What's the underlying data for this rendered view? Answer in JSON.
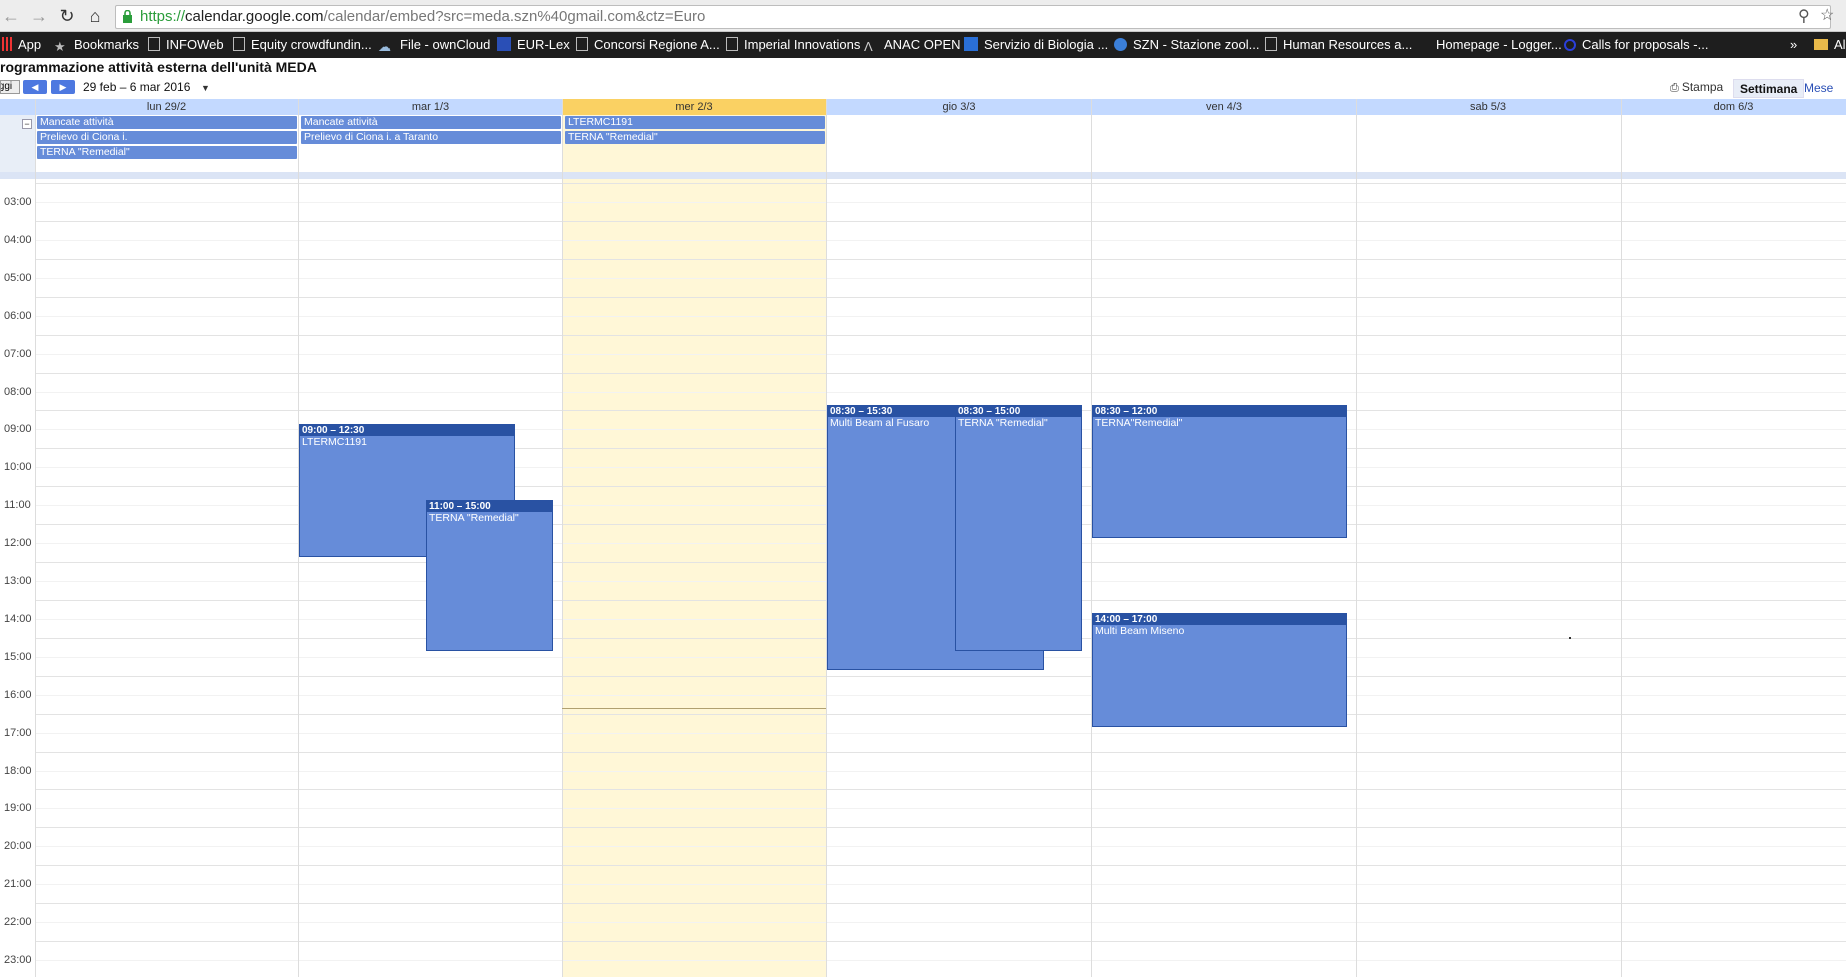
{
  "browser": {
    "url_prefix": "https://",
    "url_host": "calendar.google.com",
    "url_rest": "/calendar/embed?src=meda.szn%40gmail.com&ctz=Euro",
    "bookmarks": [
      "App",
      "Bookmarks",
      "INFOWeb",
      "Equity crowdfundin...",
      "File - ownCloud",
      "EUR-Lex",
      "Concorsi Regione A...",
      "Imperial Innovations",
      "ANAC OPEN",
      "Servizio di Biologia ...",
      "SZN - Stazione zool...",
      "Human Resources a...",
      "Homepage - Logger...",
      "Calls for proposals -...",
      "»",
      "Al"
    ]
  },
  "calendar": {
    "title": "rogrammazione attività esterna dell'unità MEDA",
    "today_label": "Oggi",
    "date_range": "29 feb – 6 mar 2016",
    "print_label": "Stampa",
    "view_week": "Settimana",
    "view_month": "Mese",
    "days": [
      "lun 29/2",
      "mar 1/3",
      "mer 2/3",
      "gio 3/3",
      "ven 4/3",
      "sab 5/3",
      "dom 6/3"
    ],
    "allday": {
      "mon": [
        "Mancate attività",
        "Prelievo di Ciona i.",
        "TERNA \"Remedial\""
      ],
      "tue": [
        "Mancate attività",
        "Prelievo di Ciona i. a Taranto"
      ],
      "wed": [
        "LTERMC1191",
        "TERNA \"Remedial\""
      ]
    },
    "hours": [
      "03:00",
      "04:00",
      "05:00",
      "06:00",
      "07:00",
      "08:00",
      "09:00",
      "10:00",
      "11:00",
      "12:00",
      "13:00",
      "14:00",
      "15:00",
      "16:00",
      "17:00",
      "18:00",
      "19:00",
      "20:00",
      "21:00",
      "22:00",
      "23:00"
    ],
    "events": [
      {
        "time": "09:00 – 12:30",
        "title": "LTERMC1191"
      },
      {
        "time": "11:00 – 15:00",
        "title": "TERNA \"Remedial\""
      },
      {
        "time": "08:30 – 15:30",
        "title": "Multi Beam al Fusaro"
      },
      {
        "time": "08:30 – 15:00",
        "title": "TERNA \"Remedial\""
      },
      {
        "time": "08:30 – 12:00",
        "title": "TERNA\"Remedial\""
      },
      {
        "time": "14:00 – 17:00",
        "title": "Multi Beam Miseno"
      }
    ]
  }
}
